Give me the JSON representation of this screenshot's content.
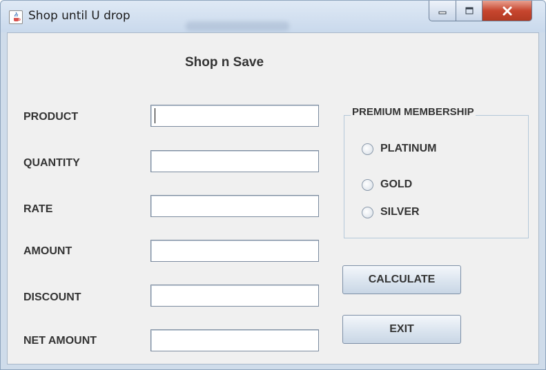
{
  "window": {
    "title": "Shop until U drop",
    "app_icon": "java-cup-icon",
    "controls": {
      "minimize": "minimize-icon",
      "maximize": "maximize-icon",
      "close": "close-icon"
    }
  },
  "form": {
    "heading": "Shop n Save",
    "fields": [
      {
        "label": "PRODUCT",
        "value": ""
      },
      {
        "label": "QUANTITY",
        "value": ""
      },
      {
        "label": "RATE",
        "value": ""
      },
      {
        "label": "AMOUNT",
        "value": ""
      },
      {
        "label": "DISCOUNT",
        "value": ""
      },
      {
        "label": "NET AMOUNT",
        "value": ""
      }
    ]
  },
  "membership": {
    "title": "PREMIUM MEMBERSHIP",
    "options": [
      "PLATINUM",
      "GOLD",
      "SILVER"
    ],
    "selected": null
  },
  "buttons": {
    "calculate": "CALCULATE",
    "exit": "EXIT"
  },
  "colors": {
    "window_frame": "#cfdcea",
    "client_bg": "#f0f0f0",
    "close_button": "#c7462f",
    "text": "#333333"
  }
}
